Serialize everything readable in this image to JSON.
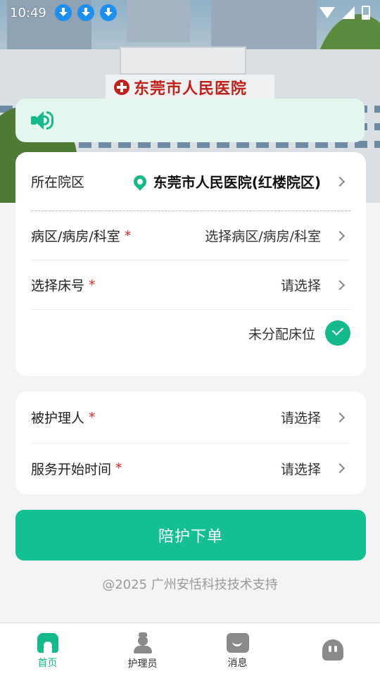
{
  "status_bar": {
    "time": "10:49"
  },
  "hero": {
    "sign_text": "东莞市人民医院"
  },
  "form": {
    "campus_label": "所在院区",
    "campus_value": "东莞市人民医院(红楼院区)",
    "ward_label": "病区/病房/科室",
    "ward_placeholder": "选择病区/病房/科室",
    "bed_label": "选择床号",
    "bed_placeholder": "请选择",
    "unassigned_label": "未分配床位",
    "patient_label": "被护理人",
    "patient_placeholder": "请选择",
    "start_time_label": "服务开始时间",
    "start_time_placeholder": "请选择",
    "required_mark": "*"
  },
  "submit": {
    "label": "陪护下单"
  },
  "footer": {
    "text": "@2025 广州安恬科技技术支持"
  },
  "tab_bar": {
    "items": [
      {
        "label": "首页",
        "icon": "home-icon",
        "active": true
      },
      {
        "label": "护理员",
        "icon": "nurse-icon",
        "active": false
      },
      {
        "label": "消息",
        "icon": "message-icon",
        "active": false
      },
      {
        "label": "",
        "icon": "profile-icon",
        "active": false
      }
    ]
  },
  "colors": {
    "accent": "#16b98c",
    "required": "#e0252a",
    "notice_bg": "#e4f7ee"
  }
}
